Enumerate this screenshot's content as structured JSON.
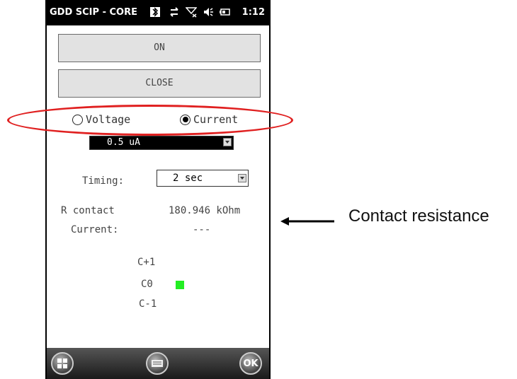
{
  "statusbar": {
    "title": "GDD SCIP - CORE",
    "time": "1:12"
  },
  "buttons": {
    "on": "ON",
    "close": "CLOSE"
  },
  "mode": {
    "voltage_label": "Voltage",
    "current_label": "Current",
    "selected": "Current"
  },
  "current_range": {
    "value": "0.5 uA"
  },
  "timing": {
    "label": "Timing:",
    "value": "2 sec"
  },
  "readings": {
    "r_contact_label": "R contact",
    "r_contact_value": "180.946 kOhm",
    "current_label": "Current:",
    "current_value": "---"
  },
  "channels": {
    "c_plus1": "C+1",
    "c0": "C0",
    "c_minus1": "C-1",
    "indicator_color": "#22ee22"
  },
  "bottombar": {
    "ok_label": "OK"
  },
  "annotation": {
    "text": "Contact resistance"
  },
  "colors": {
    "highlight": "#e02020"
  }
}
